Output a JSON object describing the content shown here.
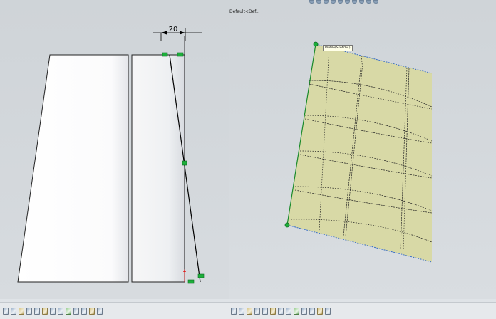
{
  "sketch_view": {
    "dimension_value": "20"
  },
  "model_view": {
    "configuration_label": "Default<Def...",
    "tooltip": "Profile(Sketch4)"
  },
  "colors": {
    "viewport_bg": "#d3d8dc",
    "surface_fill": "#d8d9a6",
    "sketch_line": "#000000",
    "constraint_green": "#1cae3a",
    "edge_blue": "#3a6fc7"
  },
  "status_bar_left": {
    "icons": [
      "view-orient-icon",
      "zoom-fit-icon",
      "zoom-area-icon",
      "previous-view-icon",
      "section-view-icon",
      "view-orientation-icon",
      "display-style-icon",
      "hide-show-icon",
      "edit-appearance-icon",
      "apply-scene-icon",
      "view-settings-icon",
      "standard-views-icon",
      "display-pane-icon"
    ]
  },
  "status_bar_right": {
    "icons": [
      "view-orient-icon",
      "zoom-fit-icon",
      "zoom-area-icon",
      "previous-view-icon",
      "section-view-icon",
      "view-orientation-icon",
      "display-style-icon",
      "hide-show-icon",
      "edit-appearance-icon",
      "apply-scene-icon",
      "view-settings-icon",
      "standard-views-icon",
      "display-pane-icon"
    ]
  }
}
